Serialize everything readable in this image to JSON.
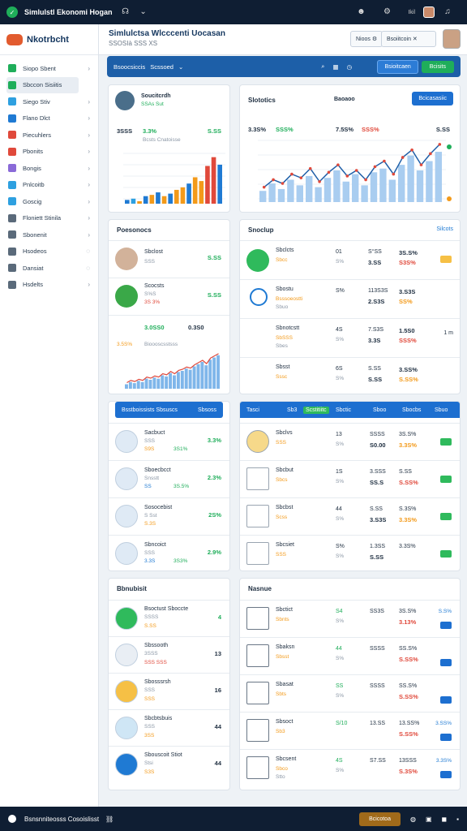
{
  "topbar": {
    "title": "Simlulstl Ekonomi Hogan",
    "icons": [
      "app-logo",
      "headset-icon",
      "chevron-down-icon",
      "avatar-icon",
      "settings-icon",
      "bell-icon"
    ],
    "right_text": "Ikil"
  },
  "sidebar": {
    "brand": "Nkotrbcht",
    "items": [
      {
        "label": "Siopo Sbent",
        "color": "#1fae5a"
      },
      {
        "label": "Sbccon Sisiitis",
        "color": "#1fae5a"
      },
      {
        "label": "Siego Stiv",
        "color": "#2ea0e0"
      },
      {
        "label": "Flano Dlct",
        "color": "#1f7ad3"
      },
      {
        "label": "Piecuhlers",
        "color": "#e0493b"
      },
      {
        "label": "Pbonits",
        "color": "#e0493b"
      },
      {
        "label": "Bongis",
        "color": "#8a6ad8"
      },
      {
        "label": "Pnlcoitb",
        "color": "#2ea0e0"
      },
      {
        "label": "Goscig",
        "color": "#2ea0e0"
      },
      {
        "label": "Floniett Stinila",
        "color": "#5a6a7a"
      },
      {
        "label": "Sbonenit",
        "color": "#5a6a7a"
      },
      {
        "label": "Hsodeos",
        "color": "#5a6a7a"
      },
      {
        "label": "Dansiat",
        "color": "#5a6a7a"
      },
      {
        "label": "Hsdelts",
        "color": "#5a6a7a"
      }
    ]
  },
  "header": {
    "title": "Simlulctsa Wlcccenti Uocasan",
    "subtitle": "SSOSIà SSS XS",
    "btn1": "Nioos",
    "btn2": "Bsoiitcoin"
  },
  "bluebar": {
    "label": "Bsoocsiccis",
    "label2": "Scssoed",
    "btn1": "Bsioitcaen",
    "btn2": "Bcisits"
  },
  "card1": {
    "name": "Soucitcrdh",
    "sub": "SSAs Sut",
    "stat1": "3SSS",
    "stat2": "3.3%",
    "stat_right": "S.SS",
    "caption": "Bcsts Cnatoisse",
    "bars": [
      3,
      4,
      2,
      6,
      7,
      9,
      6,
      8,
      11,
      13,
      16,
      21,
      18,
      30,
      37,
      31
    ],
    "bar_colors": [
      "#1f7ad3",
      "#2ea0e0",
      "#f39a1a",
      "#1f7ad3",
      "#f39a1a",
      "#1f7ad3",
      "#f39a1a",
      "#1f7ad3",
      "#f39a1a",
      "#f39a1a",
      "#1f7ad3",
      "#f39a1a",
      "#f39a1a",
      "#e0493b",
      "#e0493b",
      "#1f7ad3"
    ]
  },
  "card2": {
    "title": "Slototics",
    "mid": "Baoaoo",
    "btn": "Bcicasasiic",
    "stat1": "3.3S%",
    "stat2": "SSS%",
    "stat3": "7.5S%",
    "stat4": "SSS%",
    "stat5": "S.SS",
    "line": [
      8,
      12,
      10,
      15,
      13,
      18,
      11,
      16,
      20,
      14,
      17,
      12,
      19,
      22,
      15,
      24,
      28,
      20,
      26,
      31
    ],
    "bars": [
      6,
      10,
      7,
      12,
      9,
      14,
      8,
      13,
      17,
      11,
      15,
      9,
      16,
      18,
      12,
      20,
      25,
      17,
      22,
      27
    ]
  },
  "card3": {
    "title": "Poesonocs",
    "r1": {
      "name": "Sbclost",
      "sub": "SSS",
      "val": "S.SS"
    },
    "r2": {
      "name": "Scocsts",
      "sub": "S%S",
      "sub2": "3S 3%",
      "val": "S.SS"
    },
    "chart": {
      "v1": "3.0SS0",
      "v2": "0.3S0",
      "cap1": "3.5S%",
      "cap2": "Bioooscsstsss"
    },
    "bars": [
      4,
      6,
      5,
      7,
      6,
      9,
      8,
      10,
      9,
      12,
      11,
      14,
      12,
      15,
      16,
      18,
      17,
      20,
      22,
      24,
      21,
      26,
      28,
      30
    ]
  },
  "card4": {
    "title": "Snoclup",
    "link": "Silcots",
    "rows": [
      {
        "name": "Sbclcts",
        "sub": "Sbcc",
        "a": "01",
        "b": "S%",
        "c": "S°SS",
        "d": "3S.S%",
        "e": "3.SS",
        "f": "S3S%"
      },
      {
        "name": "Sbostu",
        "sub": "Bsssoeostti",
        "sub2": "Sbuo",
        "a": "S%",
        "b": "",
        "c": "113S3S",
        "d": "3.S3S",
        "e": "2.S3S",
        "f": "SS%"
      },
      {
        "name": "Sbnotcstt",
        "sub": "SbSSS",
        "sub2": "Sbes",
        "a": "4S",
        "b": "S%",
        "c": "7.S3S",
        "d": "1.5S0",
        "e": "3.3S",
        "f": "SSS%",
        "g": "1 m"
      },
      {
        "name": "Sbsst",
        "sub": "Sssc",
        "a": "6S",
        "b": "S%",
        "c": "S.SS",
        "d": "3.SS%",
        "e": "S.SS",
        "f": "S.SS%"
      }
    ]
  },
  "card5": {
    "hdr": "Bsstboissists Sbsuscs",
    "hdr_btn": "Sbsoss",
    "rows": [
      {
        "name": "Sacbuct",
        "sub": "SSS",
        "sub2": "S9S",
        "sub3": "3S1%",
        "val": "3.3%"
      },
      {
        "name": "Sboecbcct",
        "sub": "Snsstt",
        "sub2": "SS",
        "sub3": "3S.5%",
        "val": "2.3%"
      },
      {
        "name": "Sosocebist",
        "sub": "S Sst",
        "sub2": "S.3S",
        "val": "2S%"
      },
      {
        "name": "Sbncoict",
        "sub": "SSS",
        "sub2": "3.3S",
        "sub3": "3S3%",
        "val": "2.9%"
      }
    ]
  },
  "card6": {
    "hdr": [
      "Tasci",
      "Sb3",
      "Scstitiitc",
      "Sbctic",
      "Sboo",
      "Sbocbs",
      "Sbuo"
    ],
    "rows": [
      {
        "name": "Sbclvs",
        "sub": "SSS",
        "a": "13",
        "b": "S%",
        "c": "SSSS",
        "d": "S0.00",
        "e": "3S.S%",
        "f": "3.3S%"
      },
      {
        "name": "Sbcbut",
        "sub": "Sbcs",
        "a": "1S",
        "b": "S%",
        "c": "3.SSS",
        "d": "SS.S",
        "e": "S.SS",
        "f": "S.SS%"
      },
      {
        "name": "Sbcbst",
        "sub": "Scss",
        "a": "44",
        "b": "S%",
        "c": "S.SS",
        "d": "3.S3S",
        "e": "S.3S%",
        "f": "3.3S%"
      },
      {
        "name": "Sbcsiet",
        "sub": "SSS",
        "a": "S%",
        "b": "S%",
        "c": "1.3SS",
        "d": "S.SS",
        "e": "3.3S%"
      }
    ]
  },
  "card7": {
    "title": "Bbnubisit",
    "rows": [
      {
        "name": "Bsoctust Sboccte",
        "sub": "SSSS",
        "sub2": "S.SS",
        "val": "4",
        "color": "#2fba5c"
      },
      {
        "name": "Sbssooth",
        "sub": "3SSS",
        "sub2": "SSS SSS",
        "val": "13",
        "color": "#e9eef4"
      },
      {
        "name": "Sbosssrsh",
        "sub": "SSS",
        "sub2": "SSS",
        "val": "16",
        "color": "#f6c045"
      },
      {
        "name": "Sbcbtsbuis",
        "sub": "SSS",
        "sub2": "3SS",
        "val": "44",
        "color": "#cfe6f5"
      },
      {
        "name": "Sbouscoit Stiot",
        "sub": "Stsi",
        "sub2": "S3S",
        "val": "44",
        "color": "#1f7ad3"
      }
    ]
  },
  "card8": {
    "title": "Nasnue",
    "rows": [
      {
        "name": "Sbctict",
        "sub": "Sbnts",
        "a": "S4",
        "b": "S%",
        "c": "SS3S",
        "d": "3S.S%",
        "e": "3.13%",
        "f": "S.S%"
      },
      {
        "name": "Sbaksn",
        "sub": "Sbsst",
        "a": "44",
        "b": "S%",
        "c": "SSSS",
        "d": "SS.S%",
        "e": "S.SS%"
      },
      {
        "name": "Sbasat",
        "sub": "Sbts",
        "a": "SS",
        "b": "S%",
        "c": "SSSS",
        "d": "SS.S%",
        "e": "S.SS%"
      },
      {
        "name": "Sbsoct",
        "sub": "Sb3",
        "a": "S/10",
        "b": "",
        "c": "13.SS",
        "d": "13.SS%",
        "e": "S.SS%",
        "f": "3.SS%"
      },
      {
        "name": "Sbcsent",
        "sub": "Sbco",
        "sub2": "Stto",
        "a": "4S",
        "b": "S%",
        "c": "S7.SS",
        "d": "13SSS",
        "e": "S.3S%",
        "f": "3.3S%"
      }
    ]
  },
  "footer": {
    "label": "Bsnsnniteosss Cosoislisst",
    "btn": "Bcicotoa"
  }
}
